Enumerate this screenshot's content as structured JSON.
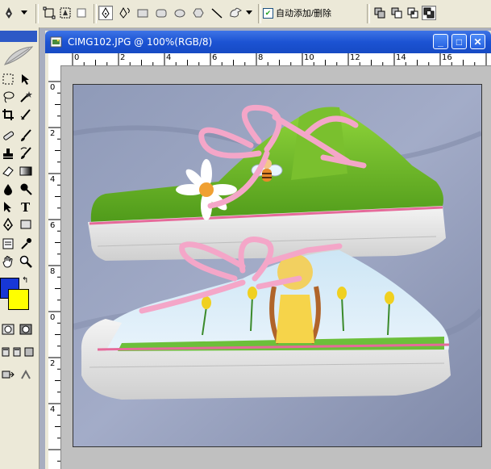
{
  "options_bar": {
    "auto_add_delete_label": "自动添加/删除",
    "auto_add_delete_checked": true
  },
  "document": {
    "title": "CIMG102.JPG @ 100%(RGB/8)",
    "minimize_symbol": "_",
    "maximize_symbol": "□",
    "close_symbol": "✕",
    "ruler_h_labels": [
      "0",
      "2",
      "4",
      "6",
      "8",
      "10",
      "12",
      "14",
      "16"
    ],
    "ruler_v_labels": [
      "0",
      "2",
      "4",
      "6",
      "8",
      "0",
      "2",
      "4"
    ]
  },
  "toolbox": {
    "tools": [
      "marquee-icon",
      "move-icon",
      "lasso-icon",
      "magic-wand-icon",
      "crop-icon",
      "slice-icon",
      "healing-icon",
      "brush-icon",
      "stamp-icon",
      "history-brush-icon",
      "eraser-icon",
      "gradient-icon",
      "blur-icon",
      "dodge-icon",
      "path-select-icon",
      "type-icon",
      "pen-icon",
      "shape-icon",
      "notes-icon",
      "eyedropper-icon",
      "hand-icon",
      "zoom-icon"
    ],
    "foreground_color": "#1737d6",
    "background_color": "#ffff00"
  }
}
